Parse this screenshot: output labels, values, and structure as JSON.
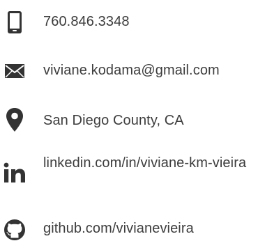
{
  "contact": {
    "phone": {
      "icon": "phone-icon",
      "text": "760.846.3348"
    },
    "email": {
      "icon": "envelope-icon",
      "text": "viviane.kodama@gmail.com"
    },
    "location": {
      "icon": "map-pin-icon",
      "text": "San Diego County, CA"
    },
    "linkedin": {
      "icon": "linkedin-icon",
      "text": "linkedin.com/in/viviane-km-vieira"
    },
    "github": {
      "icon": "github-icon",
      "text": "github.com/vivianevieira"
    }
  },
  "colors": {
    "icon": "#333333",
    "text": "#3d3d3d",
    "background": "#ffffff"
  }
}
